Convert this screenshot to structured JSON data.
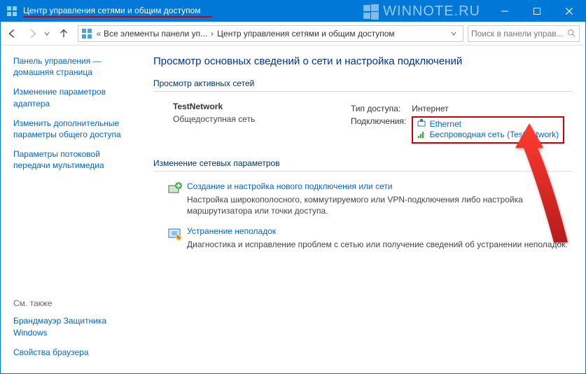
{
  "window": {
    "title": "Центр управления сетями и общим доступом"
  },
  "watermark": "WINNOTE.RU",
  "breadcrumb": {
    "level1": "Все элементы панели уп...",
    "level2": "Центр управления сетями и общим доступом"
  },
  "search": {
    "placeholder": "Поиск в панели управ..."
  },
  "sidebar": {
    "home": "Панель управления — домашняя страница",
    "adapter": "Изменение параметров адаптера",
    "sharing": "Изменить дополнительные параметры общего доступа",
    "media": "Параметры потоковой передачи мультимедиа",
    "see_also": "См. также",
    "firewall": "Брандмауэр Защитника Windows",
    "browser": "Свойства браузера"
  },
  "main": {
    "heading": "Просмотр основных сведений о сети и настройка подключений",
    "active_title": "Просмотр активных сетей",
    "network": {
      "name": "TestNetwork",
      "type": "Общедоступная сеть"
    },
    "labels": {
      "access": "Тип доступа:",
      "conn": "Подключения:"
    },
    "access_value": "Интернет",
    "conn1": "Ethernet",
    "conn2": "Беспроводная сеть (TestNetwork)",
    "change_title": "Изменение сетевых параметров",
    "task1": {
      "title": "Создание и настройка нового подключения или сети",
      "desc": "Настройка широкополосного, коммутируемого или VPN-подключения либо настройка маршрутизатора или точки доступа."
    },
    "task2": {
      "title": "Устранение неполадок",
      "desc": "Диагностика и исправление проблем с сетью или получение сведений об устранении неполадок."
    }
  }
}
